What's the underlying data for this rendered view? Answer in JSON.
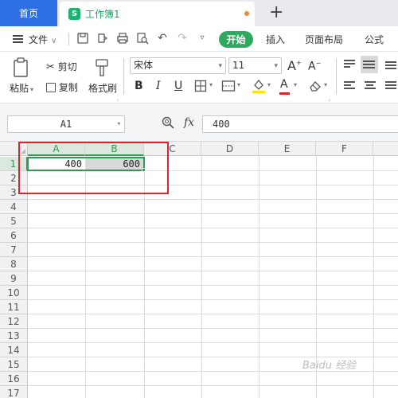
{
  "tabs": {
    "home_label": "首页",
    "doc_icon": "S",
    "doc_title": "工作簿1",
    "new_tab": "+"
  },
  "menu": {
    "file_label": "文件",
    "start_label": "开始",
    "items": [
      "插入",
      "页面布局",
      "公式"
    ]
  },
  "ribbon": {
    "paste_label": "粘贴",
    "cut_label": "剪切",
    "copy_label": "复制",
    "format_painter_label": "格式刷",
    "font_name": "宋体",
    "font_size": "11",
    "bold": "B",
    "italic": "I",
    "underline": "U",
    "grow_font": "A",
    "shrink_font": "A",
    "font_color_glyph": "A",
    "font_color": "#e0232b",
    "fill_color": "#ffe600"
  },
  "formula_bar": {
    "name_box": "A1",
    "fx_label": "fx",
    "formula_value": "400"
  },
  "sheet": {
    "columns": [
      "A",
      "B",
      "C",
      "D",
      "E",
      "F"
    ],
    "rows": [
      "1",
      "2",
      "3",
      "4",
      "5",
      "6",
      "7",
      "8",
      "9",
      "10",
      "11",
      "12",
      "13",
      "14",
      "15",
      "16",
      "17"
    ],
    "cells": {
      "A1": "400",
      "B1": "600"
    },
    "selected_range": "A1:B1",
    "accent_color": "#2a9d53",
    "highlight_color": "#e0232b"
  },
  "watermark": "Baidu 经验"
}
